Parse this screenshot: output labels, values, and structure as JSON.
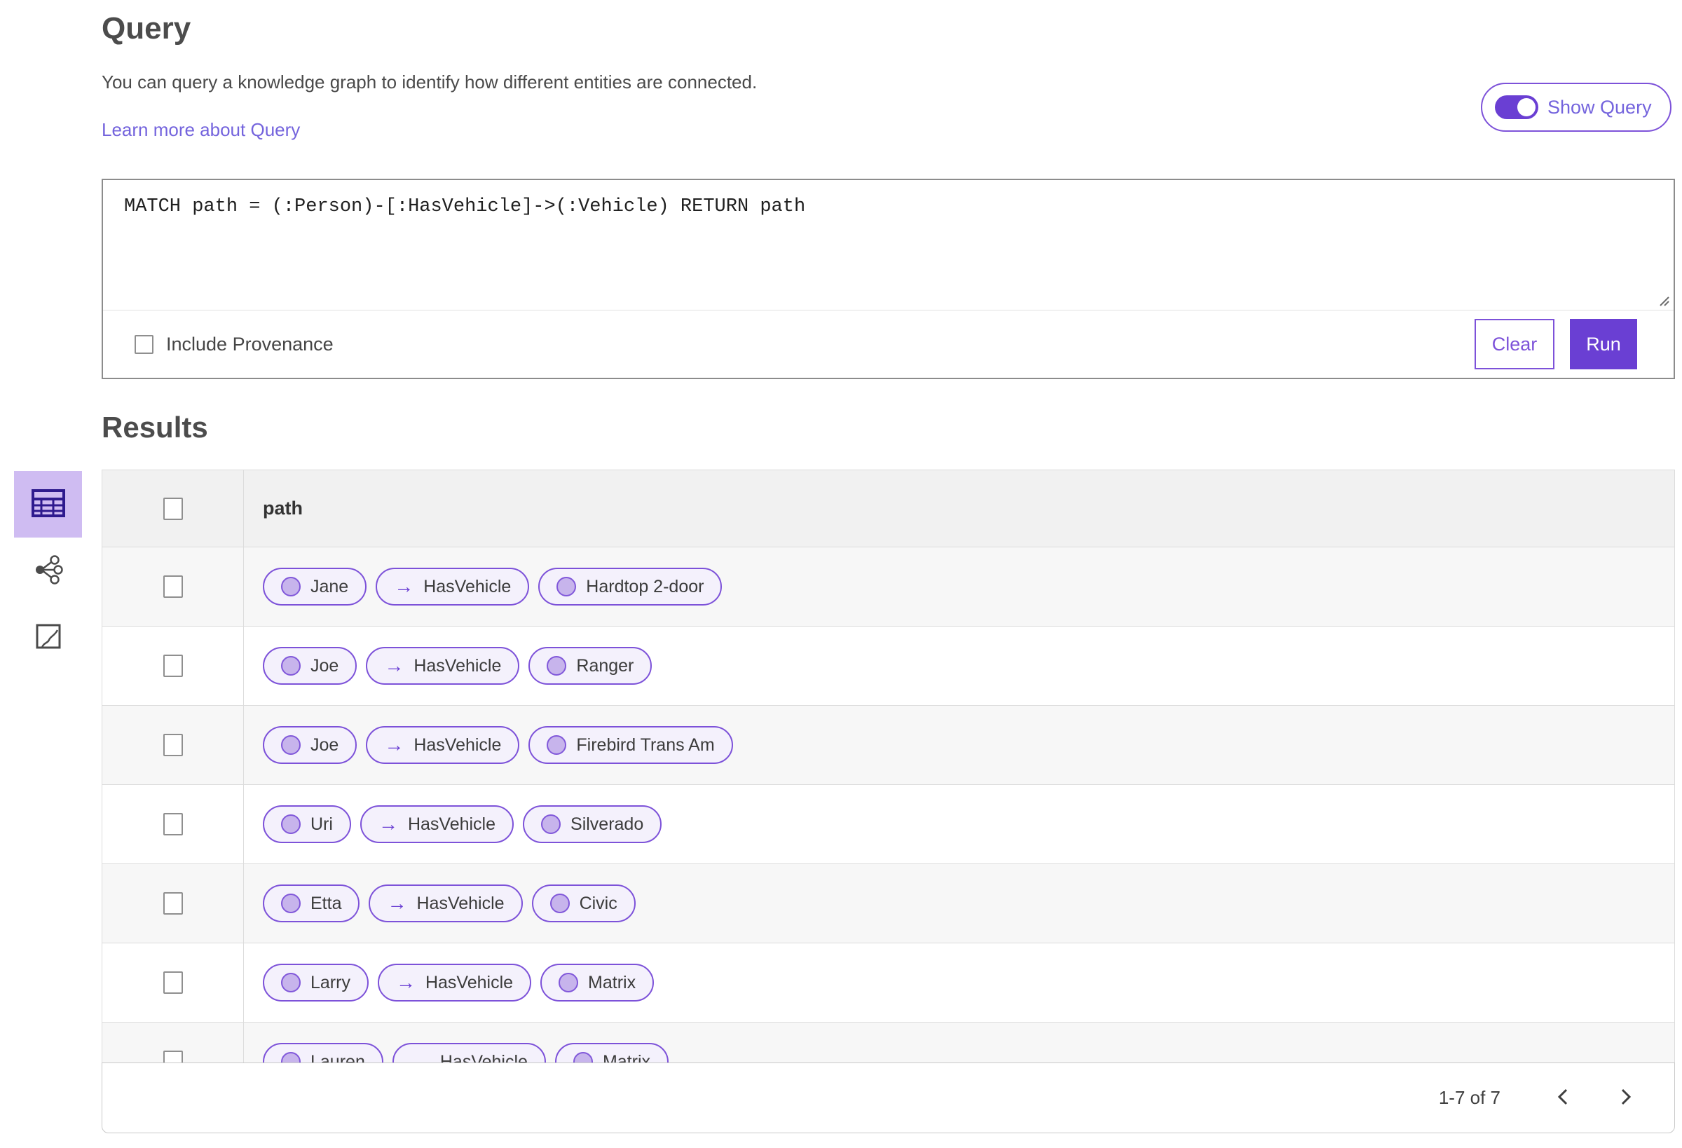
{
  "page": {
    "title": "Query",
    "description": "You can query a knowledge graph to identify how different entities are connected.",
    "learn_more": "Learn more about Query",
    "show_query_label": "Show Query",
    "query_text": "MATCH path = (:Person)-[:HasVehicle]->(:Vehicle) RETURN path",
    "include_provenance_label": "Include Provenance",
    "clear_label": "Clear",
    "run_label": "Run",
    "results_title": "Results"
  },
  "sidebar": {
    "items": [
      {
        "name": "table-view",
        "icon": "table-icon",
        "selected": true
      },
      {
        "name": "link-chart-view",
        "icon": "link-chart-icon",
        "selected": false
      },
      {
        "name": "map-view",
        "icon": "map-icon",
        "selected": false
      }
    ]
  },
  "table": {
    "column_header": "path",
    "rows": [
      {
        "source": "Jane",
        "relationship": "HasVehicle",
        "target": "Hardtop 2-door"
      },
      {
        "source": "Joe",
        "relationship": "HasVehicle",
        "target": "Ranger"
      },
      {
        "source": "Joe",
        "relationship": "HasVehicle",
        "target": "Firebird Trans Am"
      },
      {
        "source": "Uri",
        "relationship": "HasVehicle",
        "target": "Silverado"
      },
      {
        "source": "Etta",
        "relationship": "HasVehicle",
        "target": "Civic"
      },
      {
        "source": "Larry",
        "relationship": "HasVehicle",
        "target": "Matrix"
      },
      {
        "source": "Lauren",
        "relationship": "HasVehicle",
        "target": "Matrix"
      }
    ]
  },
  "pagination": {
    "range_label": "1-7 of 7"
  },
  "icons": {
    "arrow_right": "→"
  },
  "colors": {
    "accent": "#6a3fd3",
    "accent_border": "#7d52d9",
    "link": "#7464dd",
    "pill_bg": "#f4f1fc",
    "pill_circle": "#c7b4ec",
    "pill_circle_border": "#8158da",
    "selected_view_bg": "#cfbcf2",
    "icon_dark": "#2e1a8e",
    "icon_gray": "#4b4b4b",
    "text_dark": "#4c4c4c",
    "text_body": "#4a4a4a",
    "panel_border": "#8c8c8c",
    "divider": "#dcdcdc",
    "header_bg": "#f1f1f1",
    "row_alt_bg": "#f7f7f7",
    "footer_border": "#c9c9c9"
  }
}
